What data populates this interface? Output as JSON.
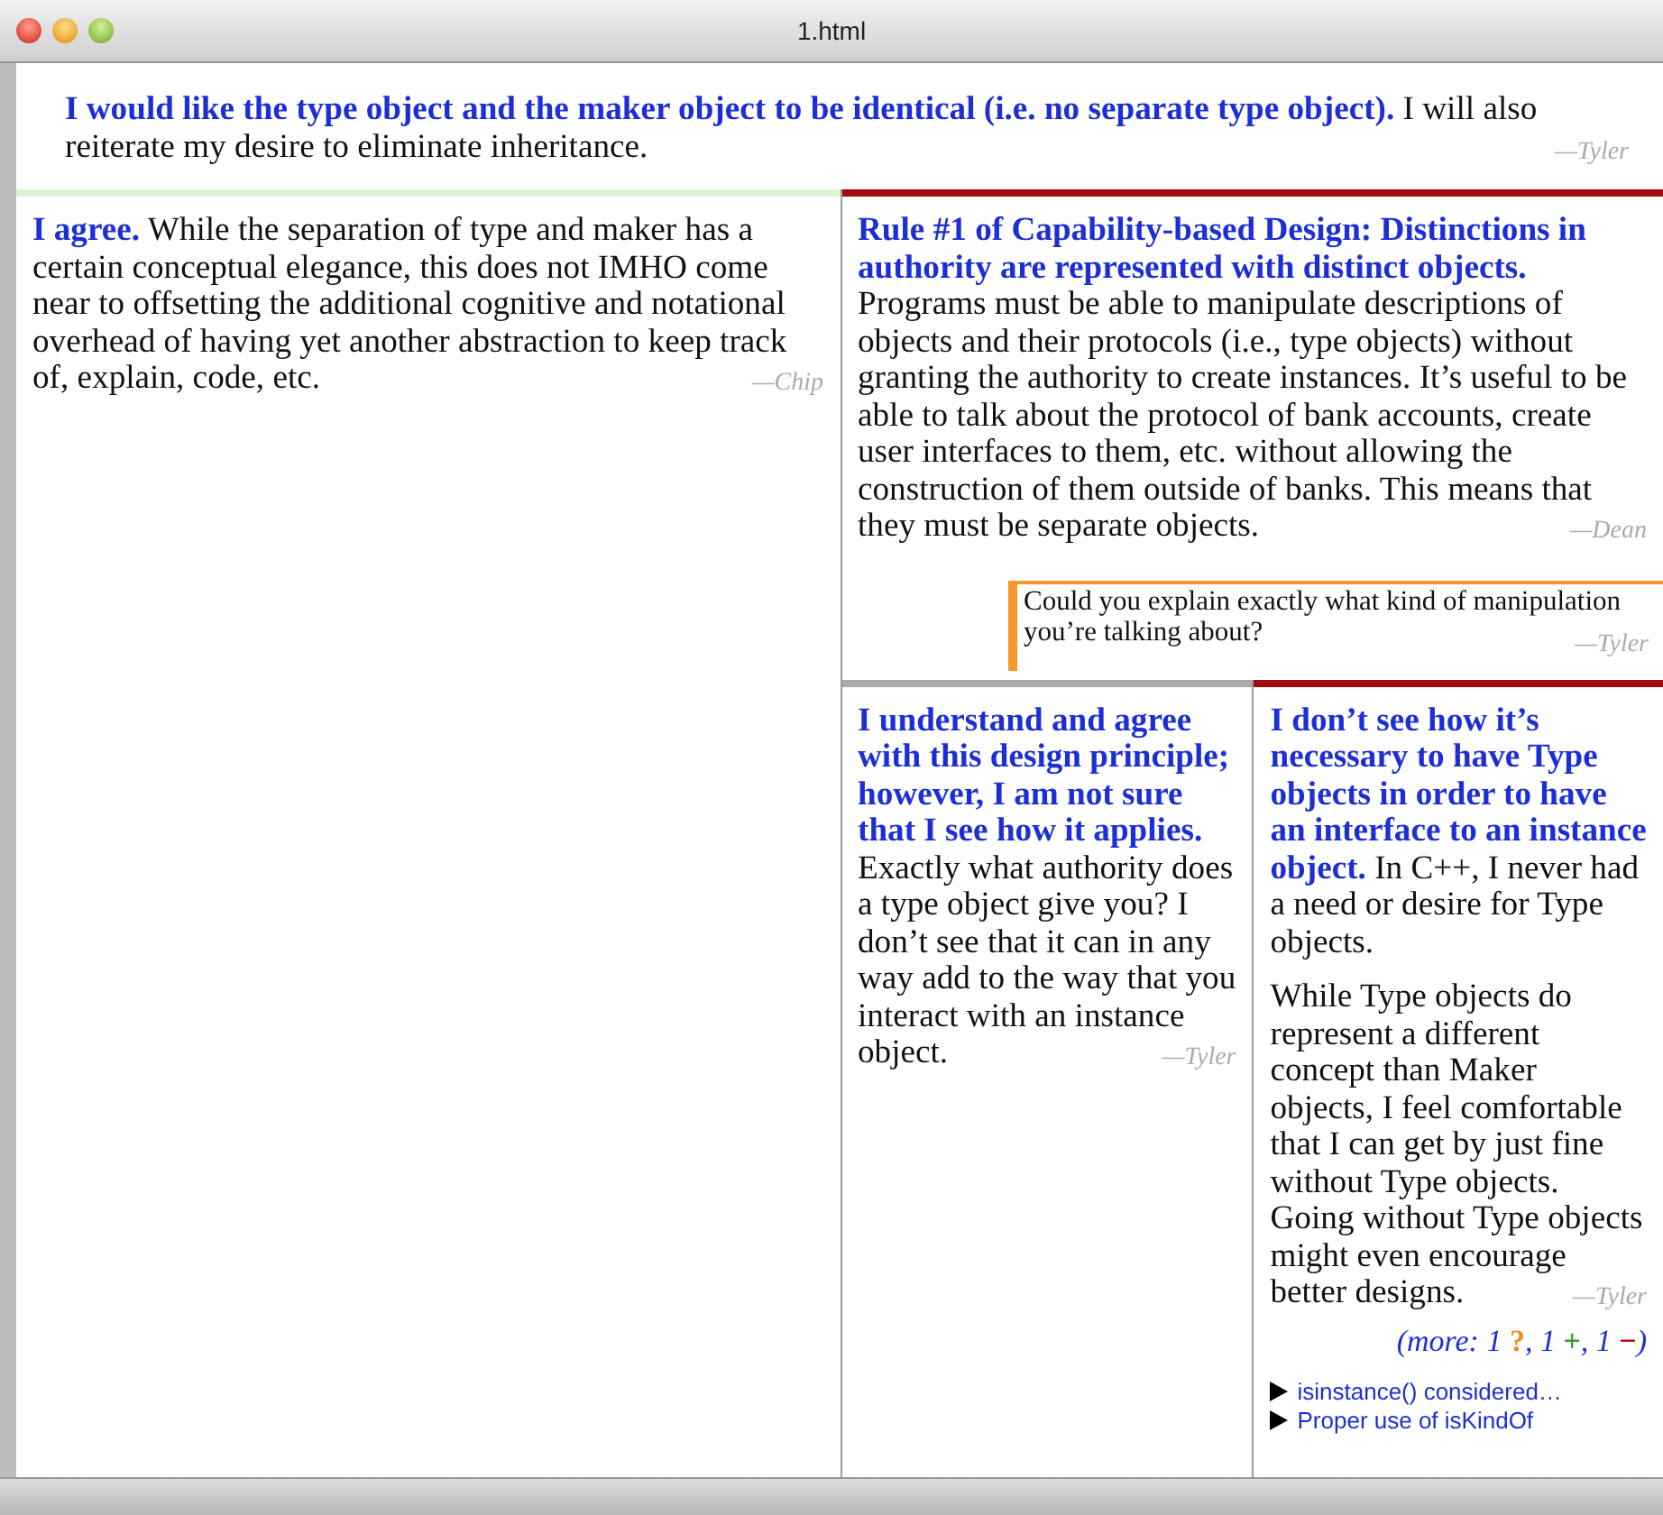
{
  "window": {
    "title": "1.html"
  },
  "thread": {
    "paragraphs": [
      "**I would like the type object and the maker object to be identical (i.e. no separate type object).** I will also reiterate my desire to eliminate inheritance."
    ],
    "author": "—Tyler",
    "replies": [
      {
        "color": "#dcf5d4",
        "paragraphs": [
          "**I agree.** While the separation of type and maker has a certain conceptual elegance, this does not IMHO come near to offsetting the additional cognitive and notational overhead of having yet another abstraction to keep track of, explain, code, etc."
        ],
        "author": "—Chip"
      },
      {
        "color": "#a00c0c",
        "paragraphs": [
          "**Rule #1 of Capability-based Design: Distinctions in authority are represented with distinct objects.** Programs must be able to manipulate descriptions of objects and their protocols (i.e., type objects) without granting the authority to create instances. It’s useful to be able to talk about the protocol of bank accounts, create user interfaces to them, etc. without allowing the construction of them outside of banks. This means that they must be separate objects."
        ],
        "author": "—Dean",
        "note": {
          "color": "#f7962a",
          "paragraphs": [
            "Could you explain exactly what kind of manipulation you’re talking about?"
          ],
          "author": "—Tyler"
        },
        "replies": [
          {
            "color": "#aaaaaa",
            "paragraphs": [
              "**I understand and agree with this design principle; however, I am not sure that I see how it applies.** Exactly what authority does a type object give you? I don’t see that it can in any way add to the way that you interact with an instance object."
            ],
            "author": "—Tyler"
          },
          {
            "color": "#a00c0c",
            "paragraphs": [
              "**I don’t see how it’s necessary to have Type objects in order to have an interface to an instance object.** In C++, I never had a need or desire for Type objects.",
              "While Type objects do represent a different concept than Maker objects, I feel comfortable that I can get by just fine without Type objects. Going without Type objects might even encourage better designs."
            ],
            "author": "—Tyler",
            "more": [
              {
                "text": "(more: 1 "
              },
              {
                "text": "?",
                "color": "#f08a24"
              },
              {
                "text": ", 1 "
              },
              {
                "text": "+",
                "color": "#3a9e2a"
              },
              {
                "text": ", 1 "
              },
              {
                "text": "−",
                "color": "#c00000"
              },
              {
                "text": ")"
              }
            ],
            "links": [
              "isinstance() considered…",
              "Proper use of isKindOf"
            ]
          }
        ]
      }
    ]
  }
}
